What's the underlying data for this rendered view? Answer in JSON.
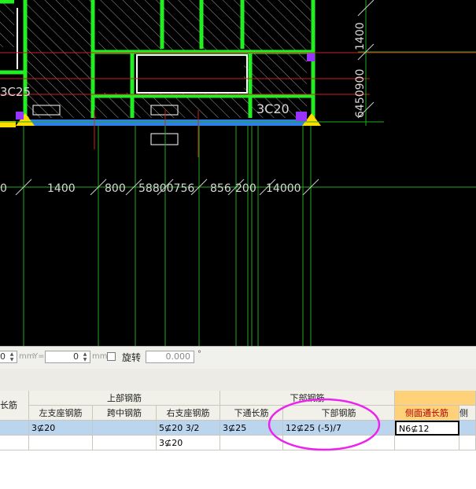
{
  "canvas": {
    "dim_labels_bottom": [
      "0",
      "1400",
      "800",
      "58800756",
      "856",
      "200",
      "14000"
    ],
    "dim_label_left": "3C25",
    "dim_label_beam": "3C20",
    "dim_labels_right": [
      "1400",
      "6450900"
    ]
  },
  "toolbar": {
    "x_value": "0",
    "y_label": "Y=",
    "y_value": "0",
    "unit_label": "mm",
    "rotate_label": "旋转",
    "rotate_value": "0.000",
    "degree": "°"
  },
  "table": {
    "group_headers": {
      "top_bars": "上部钢筋",
      "bottom_bars": "下部钢筋"
    },
    "columns": {
      "col0": "长筋",
      "left_support": "左支座钢筋",
      "midspan": "跨中钢筋",
      "right_support": "右支座钢筋",
      "bottom_through": "下通长筋",
      "bottom_bars": "下部钢筋",
      "side_through": "侧面通长筋",
      "side_partial": "侧"
    },
    "rows": [
      {
        "left_support": "3⊈20",
        "midspan": "",
        "right_support": "5⊈20 3/2",
        "bottom_through": "3⊈25",
        "bottom_bars": "12⊈25 (-5)/7",
        "side_through": "N6⊈12"
      },
      {
        "left_support": "",
        "midspan": "",
        "right_support": "3⊈20",
        "bottom_through": "",
        "bottom_bars": "",
        "side_through": ""
      }
    ]
  },
  "colors": {
    "canvas_bg": "#000000",
    "beam_green": "#22ee22",
    "highlight_row": "#bcd5ef",
    "annotation_magenta": "#ee22ee",
    "active_header": "#ffd27a"
  }
}
